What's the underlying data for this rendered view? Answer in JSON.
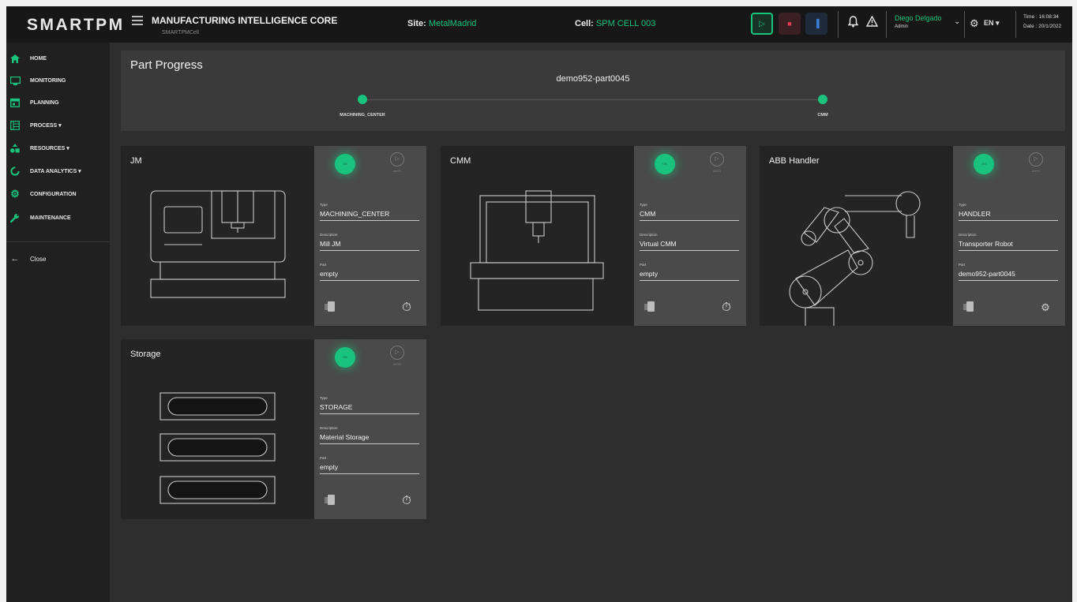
{
  "brand": "SMARTPM",
  "header": {
    "title": "MANUFACTURING INTELLIGENCE CORE",
    "subtitle": "SMARTPMCell",
    "site_label": "Site:",
    "site_value": "MetalMadrid",
    "cell_label": "Cell:",
    "cell_value": "SPM CELL 003",
    "user_name": "Diego Delgado",
    "user_role": "Admin",
    "language": "EN",
    "time": "Time : 16:08:34",
    "date": "Date : 20/1/2022"
  },
  "sidebar": {
    "items": [
      {
        "label": "HOME",
        "icon": "home-icon"
      },
      {
        "label": "MONITORING",
        "icon": "monitor-icon"
      },
      {
        "label": "PLANNING",
        "icon": "calendar-icon"
      },
      {
        "label": "PROCESS ▾",
        "icon": "process-icon"
      },
      {
        "label": "RESOURCES ▾",
        "icon": "resources-icon"
      },
      {
        "label": "DATA ANALYTICS ▾",
        "icon": "analytics-icon"
      },
      {
        "label": "CONFIGURATION",
        "icon": "gear-icon"
      },
      {
        "label": "MAINTENANCE",
        "icon": "wrench-icon"
      }
    ],
    "close_label": "Close"
  },
  "progress": {
    "title": "Part Progress",
    "part": "demo952-part0045",
    "steps": [
      "MACHINING_CENTER",
      "CMM"
    ]
  },
  "labels": {
    "type": "Type",
    "description": "Description",
    "part": "Part",
    "on": "ON",
    "auto": "AUTO"
  },
  "cards": [
    {
      "name": "JM",
      "type": "MACHINING_CENTER",
      "description": "Mill JM",
      "part": "empty",
      "bottom_icon": "stopwatch-icon"
    },
    {
      "name": "CMM",
      "type": "CMM",
      "description": "Virtual CMM",
      "part": "empty",
      "bottom_icon": "stopwatch-icon"
    },
    {
      "name": "ABB Handler",
      "type": "HANDLER",
      "description": "Transporter Robot",
      "part": "demo952-part0045",
      "bottom_icon": "gears-icon"
    },
    {
      "name": "Storage",
      "type": "STORAGE",
      "description": "Material Storage",
      "part": "empty",
      "bottom_icon": "stopwatch-icon"
    }
  ],
  "colors": {
    "accent": "#19c37d",
    "stop": "#e23c53",
    "reset": "#3a7dd8",
    "panel": "#3a3a3a",
    "background": "#2e2e2e"
  }
}
